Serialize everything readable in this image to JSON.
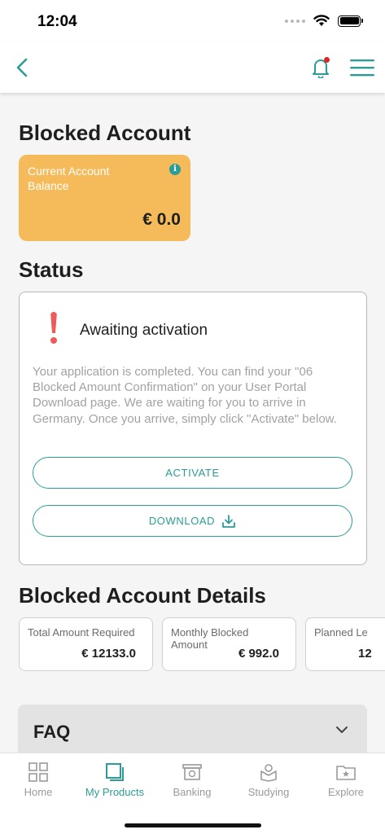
{
  "status_bar": {
    "time": "12:04"
  },
  "header": {
    "back_icon": "chevron-left-icon",
    "bell_icon": "bell-icon",
    "menu_icon": "hamburger-menu-icon",
    "accent_color": "#2b9d96",
    "notification_dot_color": "#e02424"
  },
  "page": {
    "title": "Blocked Account"
  },
  "balance_card": {
    "label": "Current Account Balance",
    "amount": "€ 0.0",
    "info_glyph": "i",
    "color": "#f5bb5b"
  },
  "status": {
    "title": "Status",
    "heading": "Awaiting activation",
    "description": "Your application is completed. You can find your \"06 Blocked Amount Confirmation\" on your User Portal Download page. We are waiting for you to arrive in Germany. Once you arrive, simply click \"Activate\" below.",
    "activate_label": "ACTIVATE",
    "download_label": "DOWNLOAD",
    "alert_color": "#ef5a5a"
  },
  "details": {
    "title": "Blocked Account Details",
    "cards": [
      {
        "label": "Total Amount Required",
        "value": "€ 12133.0"
      },
      {
        "label": "Monthly Blocked Amount",
        "value": "€ 992.0"
      },
      {
        "label": "Planned Le",
        "value": "12"
      }
    ]
  },
  "faq": {
    "title": "FAQ"
  },
  "bottom_nav": {
    "items": [
      {
        "label": "Home",
        "icon": "grid-icon",
        "active": false
      },
      {
        "label": "My Products",
        "icon": "products-icon",
        "active": true
      },
      {
        "label": "Banking",
        "icon": "bank-icon",
        "active": false
      },
      {
        "label": "Studying",
        "icon": "study-icon",
        "active": false
      },
      {
        "label": "Explore",
        "icon": "explore-folder-icon",
        "active": false
      }
    ]
  }
}
